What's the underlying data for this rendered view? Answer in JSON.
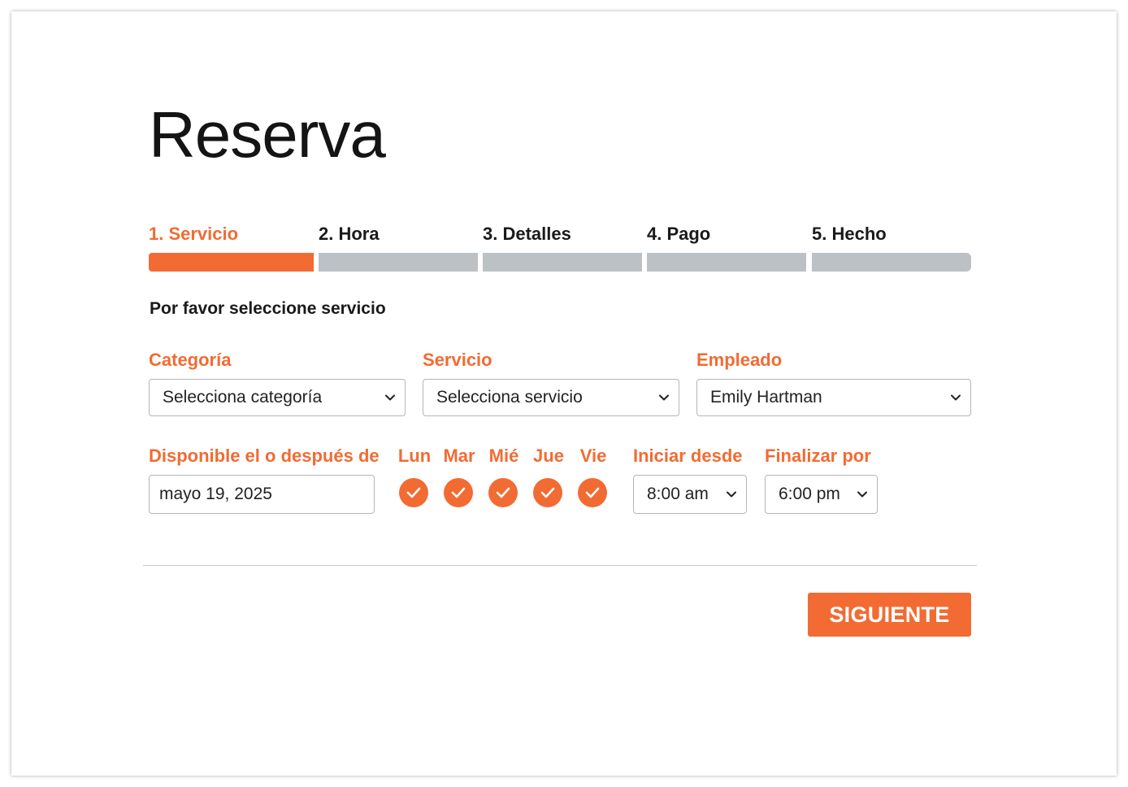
{
  "page": {
    "title": "Reserva"
  },
  "steps": [
    {
      "label": "1. Servicio",
      "active": true
    },
    {
      "label": "2. Hora",
      "active": false
    },
    {
      "label": "3. Detalles",
      "active": false
    },
    {
      "label": "4. Pago",
      "active": false
    },
    {
      "label": "5. Hecho",
      "active": false
    }
  ],
  "form": {
    "prompt": "Por favor seleccione servicio",
    "category": {
      "label": "Categoría",
      "value": "Selecciona categoría"
    },
    "service": {
      "label": "Servicio",
      "value": "Selecciona servicio"
    },
    "employee": {
      "label": "Empleado",
      "value": "Emily Hartman"
    },
    "date": {
      "label": "Disponible el o después de",
      "value": "mayo 19, 2025"
    },
    "days": [
      {
        "label": "Lun",
        "checked": true
      },
      {
        "label": "Mar",
        "checked": true
      },
      {
        "label": "Mié",
        "checked": true
      },
      {
        "label": "Jue",
        "checked": true
      },
      {
        "label": "Vie",
        "checked": true
      }
    ],
    "start": {
      "label": "Iniciar desde",
      "value": "8:00 am"
    },
    "end": {
      "label": "Finalizar por",
      "value": "6:00 pm"
    }
  },
  "actions": {
    "next_label": "SIGUIENTE"
  },
  "colors": {
    "accent": "#f26b33",
    "inactive_step": "#bcc1c5"
  },
  "icons": {
    "select_caret": "chevron-down-icon",
    "day_check": "check-icon"
  }
}
